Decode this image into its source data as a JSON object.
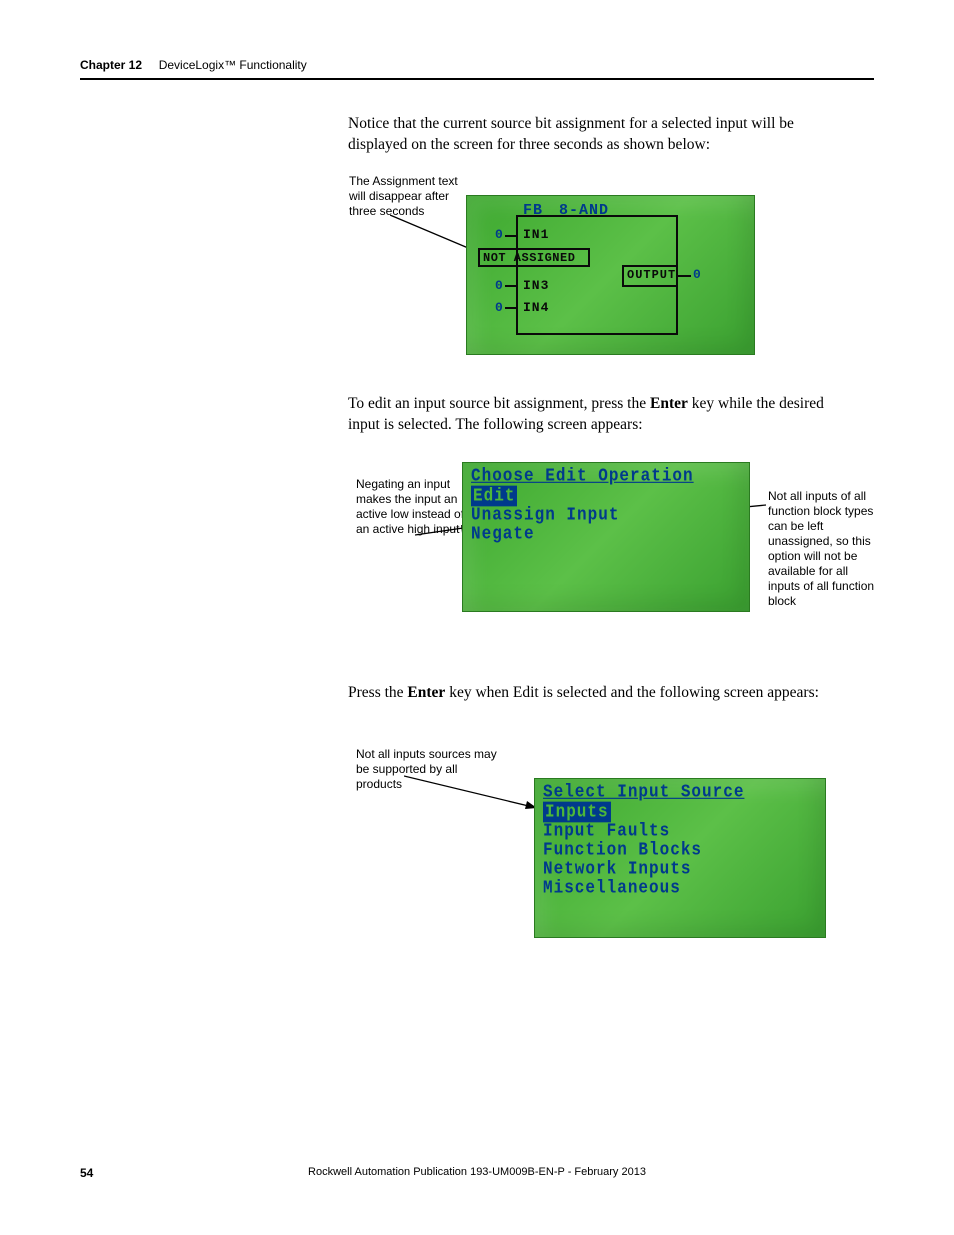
{
  "header": {
    "chapter": "Chapter 12",
    "title": "DeviceLogix™ Functionality"
  },
  "paragraphs": {
    "p1": "Notice that the current source bit assignment for a selected input will be displayed on the screen for three seconds as shown below:",
    "p2a": "To edit an input source bit assignment, press the ",
    "p2b": "Enter",
    "p2c": " key while the desired input is selected. The following screen appears:",
    "p3a": "Press the ",
    "p3b": "Enter",
    "p3c": " key when Edit is selected and the following screen appears:"
  },
  "callouts": {
    "c1": "The Assignment text will disappear after three seconds",
    "c2": "Negating an input makes the input an active low instead of an active high input",
    "c3": "Not all inputs of all function block types can be left unassigned, so this option will not be available for all inputs of all function block",
    "c4": "Not all inputs sources may be supported by all products"
  },
  "screen1": {
    "fb": "FB",
    "type": "8-AND",
    "in1_val": "0",
    "in1": "IN1",
    "not_assigned": "NOT ASSIGNED",
    "in3_val": "0",
    "in3": "IN3",
    "in4_val": "0",
    "in4": "IN4",
    "output": "OUTPUT",
    "out_val": "0"
  },
  "screen2": {
    "title": "Choose Edit Operation",
    "opt1": "Edit",
    "opt2": "Unassign Input",
    "opt3": "Negate"
  },
  "screen3": {
    "title": "Select Input Source",
    "opt1": "Inputs",
    "opt2": "Input Faults",
    "opt3": "Function Blocks",
    "opt4": "Network Inputs",
    "opt5": "Miscellaneous"
  },
  "footer": {
    "page": "54",
    "pub": "Rockwell Automation Publication 193-UM009B-EN-P - February 2013"
  }
}
